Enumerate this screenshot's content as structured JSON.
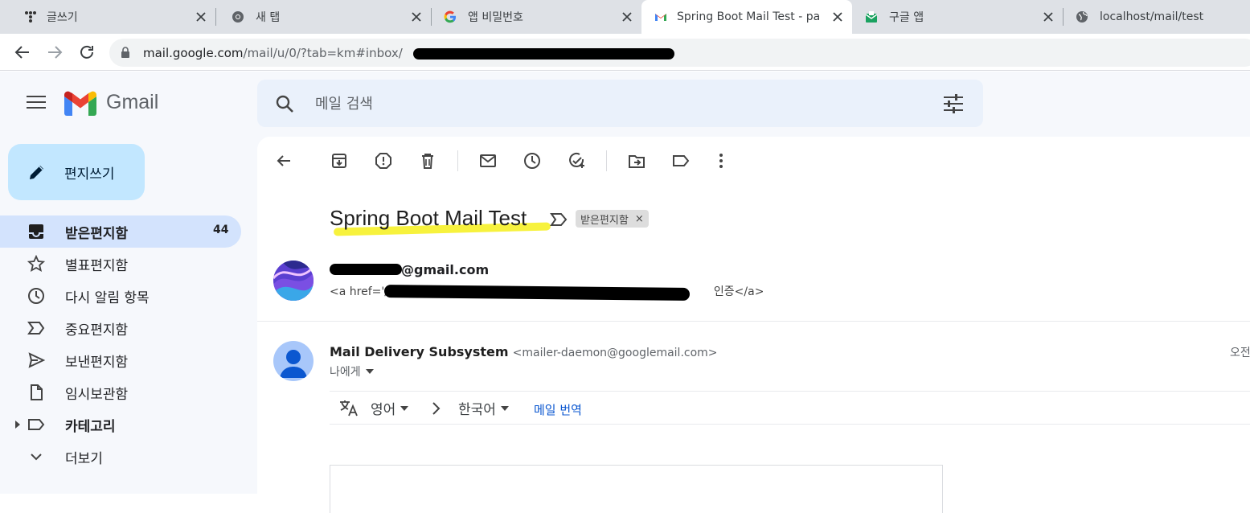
{
  "browser": {
    "tabs": [
      {
        "title": "글쓰기",
        "icon": "tistory-icon"
      },
      {
        "title": "새 탭",
        "icon": "chrome-icon"
      },
      {
        "title": "앱 비밀번호",
        "icon": "google-g-icon"
      },
      {
        "title": "Spring Boot Mail Test - pa",
        "icon": "gmail-icon",
        "active": true
      },
      {
        "title": "구글 앱",
        "icon": "mail-open-icon"
      },
      {
        "title": "localhost/mail/test",
        "icon": "globe-icon"
      }
    ],
    "url_host": "mail.google.com",
    "url_path": "/mail/u/0/?tab=km#inbox/"
  },
  "gmail": {
    "product_name": "Gmail",
    "compose_label": "편지쓰기",
    "search_placeholder": "메일 검색",
    "nav": [
      {
        "label": "받은편지함",
        "count": "44",
        "icon": "inbox-icon",
        "active": true
      },
      {
        "label": "별표편지함",
        "icon": "star-icon"
      },
      {
        "label": "다시 알림 항목",
        "icon": "clock-icon"
      },
      {
        "label": "중요편지함",
        "icon": "important-icon"
      },
      {
        "label": "보낸편지함",
        "icon": "send-icon"
      },
      {
        "label": "임시보관함",
        "icon": "draft-icon"
      },
      {
        "label": "카테고리",
        "icon": "label-icon",
        "bold": true
      },
      {
        "label": "더보기",
        "icon": "chevron-down-icon"
      }
    ]
  },
  "message": {
    "subject": "Spring Boot Mail Test",
    "label_chip": "받은편지함",
    "label_chip_close": "×",
    "first": {
      "sender_suffix": "@gmail.com",
      "snippet_start": "<a href='/",
      "snippet_end": "인증</a>"
    },
    "second": {
      "sender_name": "Mail Delivery Subsystem",
      "sender_addr": "<mailer-daemon@googlemail.com>",
      "to": "나에게",
      "time": "오전"
    },
    "translate": {
      "from": "영어",
      "to": "한국어",
      "action": "메일 번역"
    }
  },
  "colors": {
    "active_nav": "#d3e3fd",
    "compose_bg": "#c2e7ff",
    "highlight": "#f7f23d",
    "link": "#0b57d0"
  }
}
